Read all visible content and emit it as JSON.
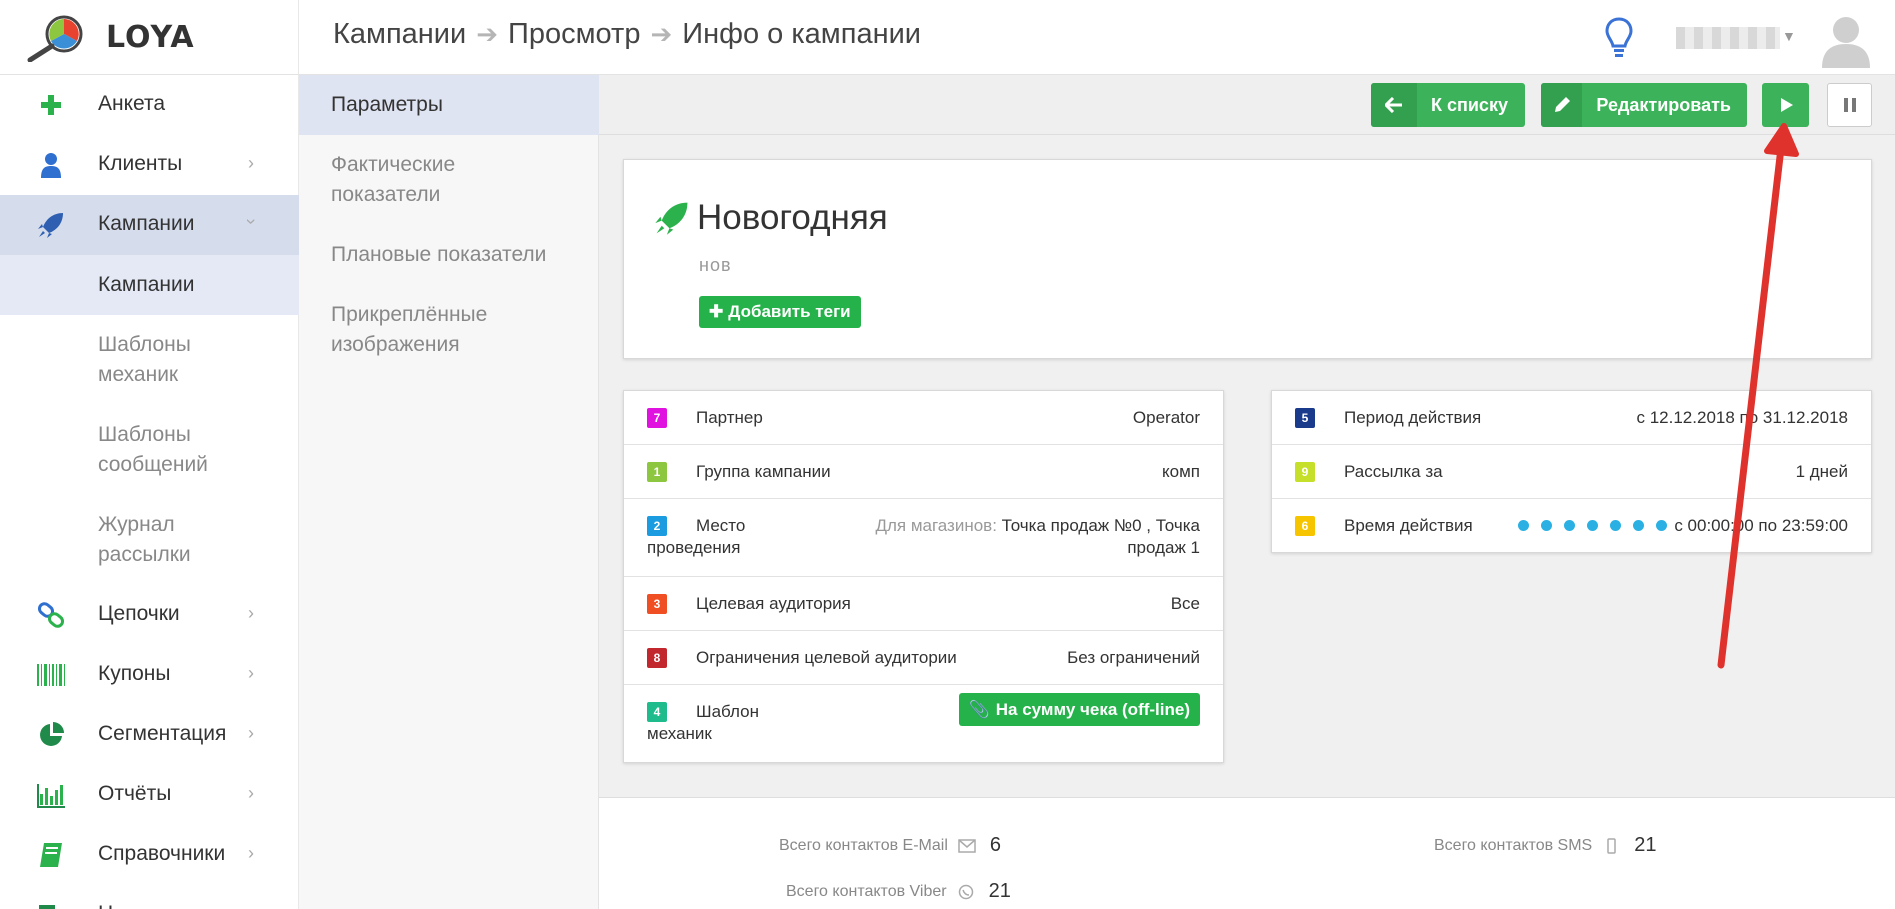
{
  "app": {
    "logo_text": "LOYA"
  },
  "breadcrumb": [
    "Кампании",
    "Просмотр",
    "Инфо о кампании"
  ],
  "sidebar": {
    "items": [
      {
        "label": "Анкета",
        "icon": "plus-icon"
      },
      {
        "label": "Клиенты",
        "icon": "user-icon"
      },
      {
        "label": "Кампании",
        "icon": "rocket-icon"
      },
      {
        "label": "Цепочки",
        "icon": "chain-icon"
      },
      {
        "label": "Купоны",
        "icon": "barcode-icon"
      },
      {
        "label": "Сегментация",
        "icon": "pie-icon"
      },
      {
        "label": "Отчёты",
        "icon": "bar-chart-icon"
      },
      {
        "label": "Справочники",
        "icon": "book-icon"
      },
      {
        "label": "Н",
        "icon": "export-icon"
      }
    ],
    "sub_items": [
      "Кампании",
      "Шаблоны механик",
      "Шаблоны сообщений",
      "Журнал рассылки"
    ]
  },
  "subpanel": {
    "items": [
      "Параметры",
      "Фактические показатели",
      "Плановые показатели",
      "Прикреплённые изображения"
    ]
  },
  "toolbar": {
    "back_label": "К списку",
    "edit_label": "Редактировать"
  },
  "campaign": {
    "title": "Новогодняя",
    "subtitle": "нов",
    "add_tags_label": "Добавить теги"
  },
  "left_rows": [
    {
      "num": "7",
      "color": "#e012e0",
      "label": "Партнер",
      "value": "Operator"
    },
    {
      "num": "1",
      "color": "#8dc63f",
      "label": "Группа кампании",
      "value": "комп"
    },
    {
      "num": "2",
      "color": "#1b9be0",
      "label": "Место",
      "label2": "проведения",
      "value_muted": "Для магазинов:",
      "value": "Точка продаж №0 , Точка",
      "value2": "продаж 1"
    },
    {
      "num": "3",
      "color": "#f04e23",
      "label": "Целевая аудитория",
      "value": "Все"
    },
    {
      "num": "8",
      "color": "#c1272d",
      "label": "Ограничения целевой аудитории",
      "value": "Без ограничений"
    },
    {
      "num": "4",
      "color": "#1ebc8c",
      "label": "Шаблон",
      "label2": "механик",
      "button": "На сумму чека (off-line)"
    }
  ],
  "right_rows": [
    {
      "num": "5",
      "color": "#1a3a8c",
      "label": "Период действия",
      "value": "с 12.12.2018 по 31.12.2018"
    },
    {
      "num": "9",
      "color": "#c6df2a",
      "label": "Рассылка за",
      "value": "1 дней"
    },
    {
      "num": "6",
      "color": "#f7c500",
      "label": "Время действия",
      "value": "с 00:00:00 по 23:59:00",
      "dots": 7
    }
  ],
  "stats": {
    "email_label": "Всего контактов E-Mail",
    "email_value": "6",
    "sms_label": "Всего контактов SMS",
    "sms_value": "21",
    "viber_label": "Всего контактов Viber",
    "viber_value": "21"
  },
  "colors": {
    "accent_green": "#3cb35a",
    "active_nav": "#d5dded",
    "arrow": "#e0322c"
  }
}
